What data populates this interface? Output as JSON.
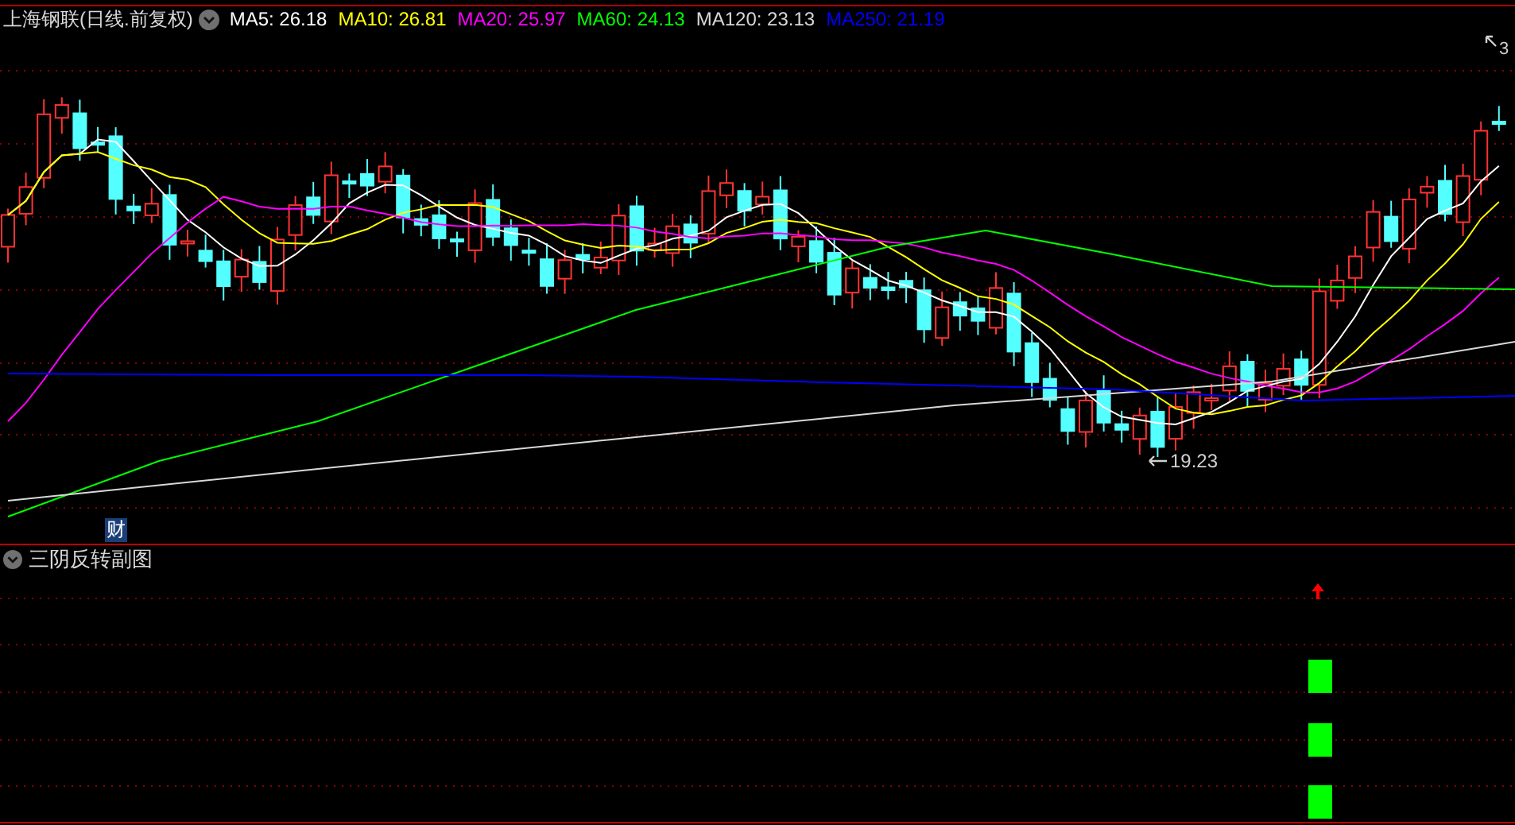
{
  "main_chart": {
    "title": "上海钢联(日线.前复权)",
    "legend": [
      {
        "label": "MA5: 26.18",
        "color": "#ffffff"
      },
      {
        "label": "MA10: 26.81",
        "color": "#ffff00"
      },
      {
        "label": "MA20: 25.97",
        "color": "#ff00ff"
      },
      {
        "label": "MA60: 24.13",
        "color": "#00ff00"
      },
      {
        "label": "MA120: 23.13",
        "color": "#d8d8d8"
      },
      {
        "label": "MA250: 21.19",
        "color": "#0000ff"
      }
    ],
    "low_marker": "19.23",
    "high_marker": "3",
    "finance_badge": "财"
  },
  "sub_chart": {
    "title": "三阴反转副图"
  }
}
